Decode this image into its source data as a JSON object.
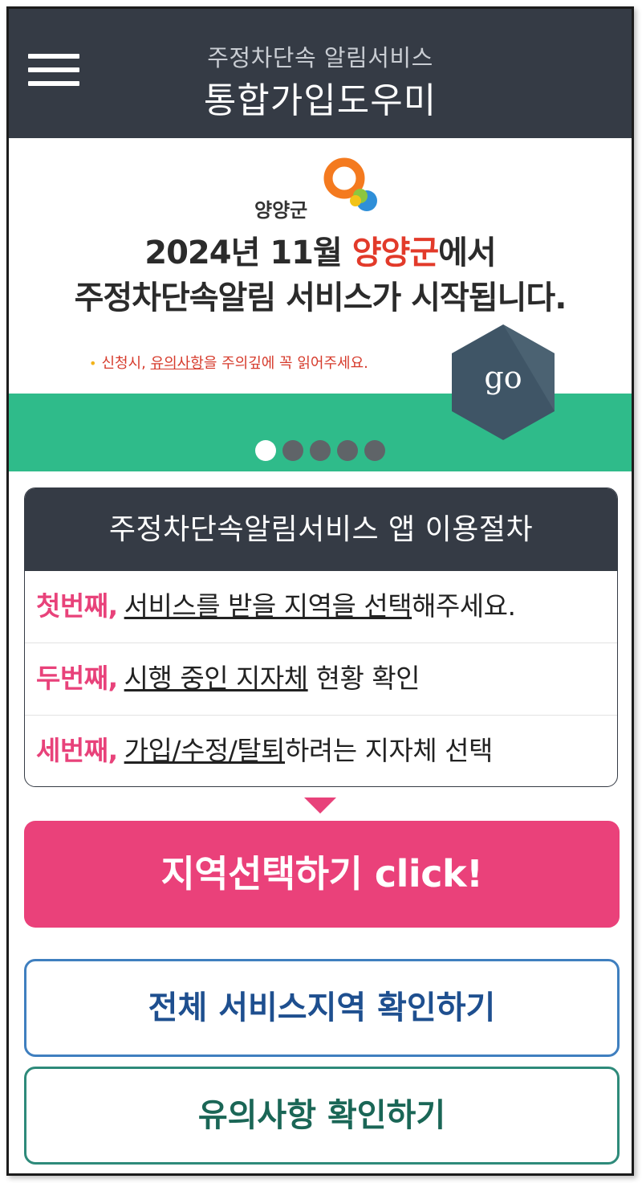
{
  "header": {
    "menu_icon": "hamburger-menu-icon",
    "subtitle": "주정차단속 알림서비스",
    "title": "통합가입도우미"
  },
  "banner": {
    "logo_text": "양양군",
    "line1_pre": "2024년 11월 ",
    "line1_highlight": "양양군",
    "line1_post": "에서",
    "line2": "주정차단속알림 서비스가 시작됩니다.",
    "note_pre": "신청시, ",
    "note_underline": "유의사항",
    "note_post": "을 주의깊에 꼭 읽어주세요.",
    "go_label": "go",
    "slide_count": 5,
    "active_slide": 1,
    "colors": {
      "green": "#2fbb8a",
      "highlight": "#e23a2a",
      "hex": "#3f5566"
    }
  },
  "procedure": {
    "title": "주정차단속알림서비스 앱 이용절차",
    "steps": [
      {
        "ordinal": "첫번째,",
        "underlined": "서비스를 받을 지역을 선택",
        "rest": "해주세요."
      },
      {
        "ordinal": "두번째,",
        "underlined": "시행 중인 지자체",
        "rest": " 현황 확인"
      },
      {
        "ordinal": "세번째,",
        "underlined": "가입/수정/탈퇴",
        "rest": "하려는 지자체 선택"
      }
    ]
  },
  "buttons": {
    "select_region": "지역선택하기 click!",
    "view_all_regions": "전체 서비스지역 확인하기",
    "view_notice": "유의사항 확인하기"
  },
  "colors": {
    "header_bg": "#353b45",
    "accent_pink": "#ea417a",
    "blue_border": "#3f7fbf",
    "teal_border": "#2e8a7a"
  }
}
